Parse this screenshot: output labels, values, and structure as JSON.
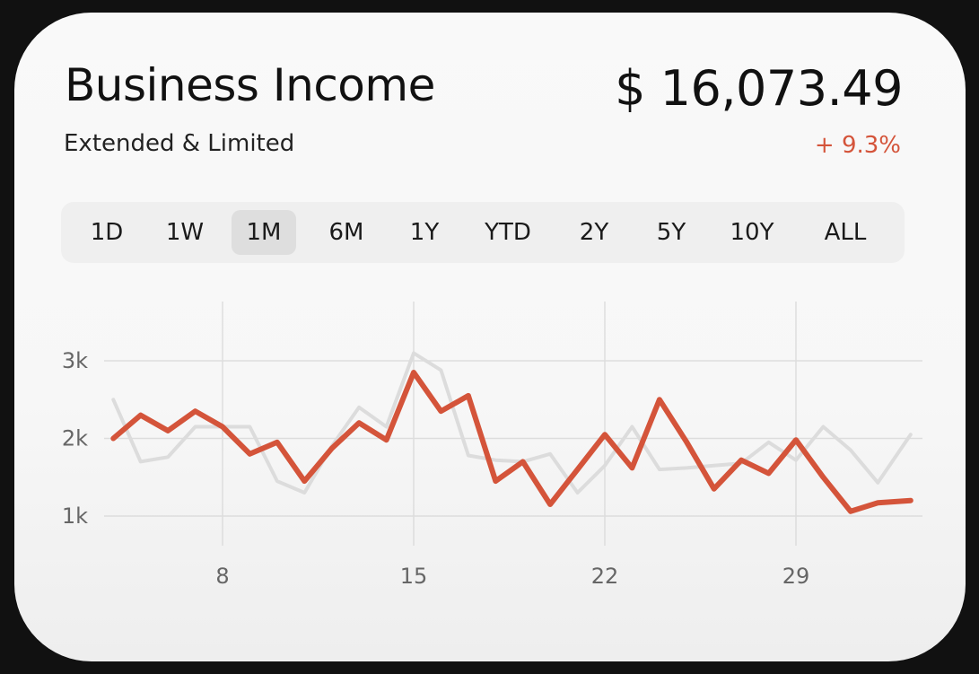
{
  "header": {
    "title": "Business Income",
    "subtitle": "Extended & Limited",
    "amount": "$ 16,073.49",
    "change": "+ 9.3%"
  },
  "ranges": {
    "items": [
      "1D",
      "1W",
      "1M",
      "6M",
      "1Y",
      "YTD",
      "2Y",
      "5Y",
      "10Y",
      "ALL"
    ],
    "selected": "1M"
  },
  "colors": {
    "primary_line": "#d4543a",
    "comparison_line": "#dcdcdc",
    "positive_change": "#d4543a",
    "grid": "#dddddd"
  },
  "chart_data": {
    "type": "line",
    "title": "",
    "xlabel": "",
    "ylabel": "",
    "x_ticks": [
      8,
      15,
      22,
      29
    ],
    "y_ticks": [
      1000,
      2000,
      3000
    ],
    "y_tick_labels": [
      "1k",
      "2k",
      "3k"
    ],
    "xlim": [
      4,
      33.5
    ],
    "ylim": [
      500,
      3900
    ],
    "grid": true,
    "series": [
      {
        "role": "comparison",
        "x": [
          4,
          5,
          6,
          7,
          8,
          9,
          10,
          11,
          12,
          13,
          14,
          15,
          16,
          17,
          18,
          19,
          20,
          21,
          22,
          23,
          24,
          25,
          26,
          27,
          28,
          29,
          30,
          31,
          32,
          33.2
        ],
        "values": [
          2500,
          1700,
          1760,
          2150,
          2150,
          2150,
          1450,
          1300,
          1900,
          2400,
          2150,
          3100,
          2880,
          1780,
          1720,
          1700,
          1800,
          1300,
          1650,
          2150,
          1600,
          1620,
          1650,
          1680,
          1950,
          1720,
          2150,
          1850,
          1430,
          2050
        ]
      },
      {
        "role": "primary",
        "x": [
          4,
          5,
          6,
          7,
          8,
          9,
          10,
          11,
          12,
          13,
          14,
          15,
          16,
          17,
          18,
          19,
          20,
          21,
          22,
          23,
          24,
          25,
          26,
          27,
          28,
          29,
          30,
          31,
          32,
          33.2
        ],
        "values": [
          2000,
          2300,
          2100,
          2350,
          2150,
          1800,
          1950,
          1450,
          1870,
          2200,
          1980,
          2850,
          2350,
          2550,
          1450,
          1700,
          1150,
          1600,
          2050,
          1620,
          2500,
          1950,
          1350,
          1720,
          1550,
          1980,
          1500,
          1060,
          1170,
          1200
        ]
      }
    ]
  }
}
